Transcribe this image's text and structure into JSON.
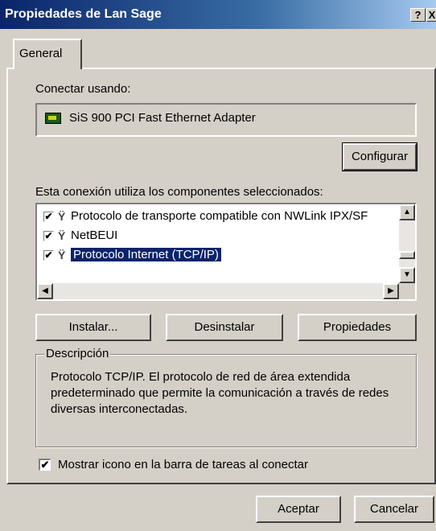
{
  "window": {
    "title": "Propiedades de Lan Sage",
    "help_glyph": "?",
    "close_glyph": "X"
  },
  "tabs": [
    {
      "label": "General"
    }
  ],
  "connect": {
    "label": "Conectar usando:",
    "adapter": "SiS 900 PCI Fast Ethernet Adapter",
    "configure_button": "Configurar"
  },
  "components": {
    "label": "Esta conexión utiliza los componentes seleccionados:",
    "items": [
      {
        "label": "Protocolo de transporte compatible con NWLink IPX/SF",
        "checked": true,
        "selected": false
      },
      {
        "label": "NetBEUI",
        "checked": true,
        "selected": false
      },
      {
        "label": "Protocolo Internet (TCP/IP)",
        "checked": true,
        "selected": true
      }
    ],
    "check_glyph": "✔"
  },
  "actions": {
    "install": "Instalar...",
    "uninstall": "Desinstalar",
    "properties": "Propiedades"
  },
  "description": {
    "legend": "Descripción",
    "text": "Protocolo TCP/IP. El protocolo de red de área extendida predeterminado que permite la comunicación a través de redes diversas interconectadas."
  },
  "show_icon": {
    "label": "Mostrar icono en la barra de tareas al conectar",
    "checked": true,
    "check_glyph": "✔"
  },
  "footer": {
    "ok": "Aceptar",
    "cancel": "Cancelar"
  },
  "icons": {
    "network_card": "network-card-icon",
    "protocol": "network-protocol-icon",
    "scroll_up": "▲",
    "scroll_down": "▼",
    "scroll_left": "◀",
    "scroll_right": "▶"
  },
  "colors": {
    "face": "#d4d0c8",
    "title_start": "#0a246a",
    "title_end": "#a6caf0",
    "selection": "#0a246a"
  }
}
